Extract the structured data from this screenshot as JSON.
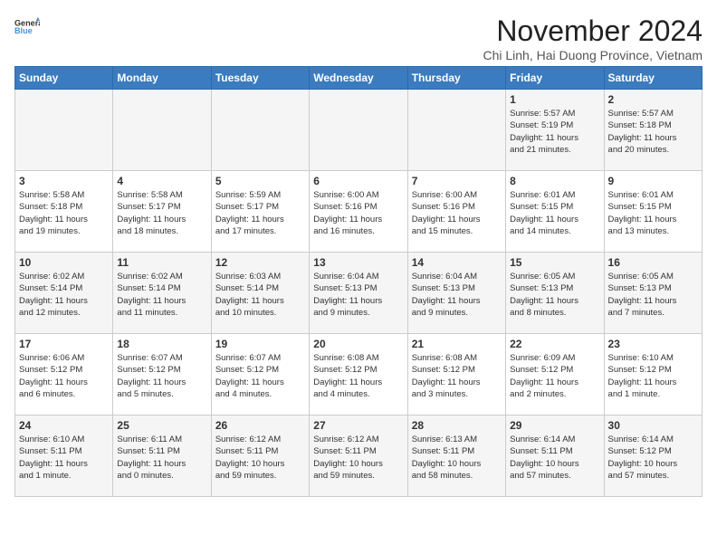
{
  "header": {
    "logo_line1": "General",
    "logo_line2": "Blue",
    "month_title": "November 2024",
    "location": "Chi Linh, Hai Duong Province, Vietnam"
  },
  "weekdays": [
    "Sunday",
    "Monday",
    "Tuesday",
    "Wednesday",
    "Thursday",
    "Friday",
    "Saturday"
  ],
  "weeks": [
    [
      {
        "day": "",
        "info": ""
      },
      {
        "day": "",
        "info": ""
      },
      {
        "day": "",
        "info": ""
      },
      {
        "day": "",
        "info": ""
      },
      {
        "day": "",
        "info": ""
      },
      {
        "day": "1",
        "info": "Sunrise: 5:57 AM\nSunset: 5:19 PM\nDaylight: 11 hours\nand 21 minutes."
      },
      {
        "day": "2",
        "info": "Sunrise: 5:57 AM\nSunset: 5:18 PM\nDaylight: 11 hours\nand 20 minutes."
      }
    ],
    [
      {
        "day": "3",
        "info": "Sunrise: 5:58 AM\nSunset: 5:18 PM\nDaylight: 11 hours\nand 19 minutes."
      },
      {
        "day": "4",
        "info": "Sunrise: 5:58 AM\nSunset: 5:17 PM\nDaylight: 11 hours\nand 18 minutes."
      },
      {
        "day": "5",
        "info": "Sunrise: 5:59 AM\nSunset: 5:17 PM\nDaylight: 11 hours\nand 17 minutes."
      },
      {
        "day": "6",
        "info": "Sunrise: 6:00 AM\nSunset: 5:16 PM\nDaylight: 11 hours\nand 16 minutes."
      },
      {
        "day": "7",
        "info": "Sunrise: 6:00 AM\nSunset: 5:16 PM\nDaylight: 11 hours\nand 15 minutes."
      },
      {
        "day": "8",
        "info": "Sunrise: 6:01 AM\nSunset: 5:15 PM\nDaylight: 11 hours\nand 14 minutes."
      },
      {
        "day": "9",
        "info": "Sunrise: 6:01 AM\nSunset: 5:15 PM\nDaylight: 11 hours\nand 13 minutes."
      }
    ],
    [
      {
        "day": "10",
        "info": "Sunrise: 6:02 AM\nSunset: 5:14 PM\nDaylight: 11 hours\nand 12 minutes."
      },
      {
        "day": "11",
        "info": "Sunrise: 6:02 AM\nSunset: 5:14 PM\nDaylight: 11 hours\nand 11 minutes."
      },
      {
        "day": "12",
        "info": "Sunrise: 6:03 AM\nSunset: 5:14 PM\nDaylight: 11 hours\nand 10 minutes."
      },
      {
        "day": "13",
        "info": "Sunrise: 6:04 AM\nSunset: 5:13 PM\nDaylight: 11 hours\nand 9 minutes."
      },
      {
        "day": "14",
        "info": "Sunrise: 6:04 AM\nSunset: 5:13 PM\nDaylight: 11 hours\nand 9 minutes."
      },
      {
        "day": "15",
        "info": "Sunrise: 6:05 AM\nSunset: 5:13 PM\nDaylight: 11 hours\nand 8 minutes."
      },
      {
        "day": "16",
        "info": "Sunrise: 6:05 AM\nSunset: 5:13 PM\nDaylight: 11 hours\nand 7 minutes."
      }
    ],
    [
      {
        "day": "17",
        "info": "Sunrise: 6:06 AM\nSunset: 5:12 PM\nDaylight: 11 hours\nand 6 minutes."
      },
      {
        "day": "18",
        "info": "Sunrise: 6:07 AM\nSunset: 5:12 PM\nDaylight: 11 hours\nand 5 minutes."
      },
      {
        "day": "19",
        "info": "Sunrise: 6:07 AM\nSunset: 5:12 PM\nDaylight: 11 hours\nand 4 minutes."
      },
      {
        "day": "20",
        "info": "Sunrise: 6:08 AM\nSunset: 5:12 PM\nDaylight: 11 hours\nand 4 minutes."
      },
      {
        "day": "21",
        "info": "Sunrise: 6:08 AM\nSunset: 5:12 PM\nDaylight: 11 hours\nand 3 minutes."
      },
      {
        "day": "22",
        "info": "Sunrise: 6:09 AM\nSunset: 5:12 PM\nDaylight: 11 hours\nand 2 minutes."
      },
      {
        "day": "23",
        "info": "Sunrise: 6:10 AM\nSunset: 5:12 PM\nDaylight: 11 hours\nand 1 minute."
      }
    ],
    [
      {
        "day": "24",
        "info": "Sunrise: 6:10 AM\nSunset: 5:11 PM\nDaylight: 11 hours\nand 1 minute."
      },
      {
        "day": "25",
        "info": "Sunrise: 6:11 AM\nSunset: 5:11 PM\nDaylight: 11 hours\nand 0 minutes."
      },
      {
        "day": "26",
        "info": "Sunrise: 6:12 AM\nSunset: 5:11 PM\nDaylight: 10 hours\nand 59 minutes."
      },
      {
        "day": "27",
        "info": "Sunrise: 6:12 AM\nSunset: 5:11 PM\nDaylight: 10 hours\nand 59 minutes."
      },
      {
        "day": "28",
        "info": "Sunrise: 6:13 AM\nSunset: 5:11 PM\nDaylight: 10 hours\nand 58 minutes."
      },
      {
        "day": "29",
        "info": "Sunrise: 6:14 AM\nSunset: 5:11 PM\nDaylight: 10 hours\nand 57 minutes."
      },
      {
        "day": "30",
        "info": "Sunrise: 6:14 AM\nSunset: 5:12 PM\nDaylight: 10 hours\nand 57 minutes."
      }
    ]
  ]
}
